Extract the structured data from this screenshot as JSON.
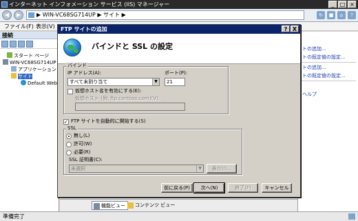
{
  "window": {
    "title": "インターネット インフォメーション サービス (IIS) マネージャー",
    "controls": {
      "minimize": "_",
      "maximize": "□",
      "close": "×"
    }
  },
  "address": {
    "back": "◀",
    "forward": "▶",
    "path": "▶ WIN-VC68SG714UP ▶ サイト ▶",
    "right_icons": [
      "refresh-icon",
      "stop-icon",
      "home-icon",
      "help-icon"
    ]
  },
  "menu": {
    "file": "ファイル(F)",
    "view": "表示(V)"
  },
  "left_pane": {
    "header": "接続",
    "tree": [
      {
        "label": "スタート ページ",
        "icon": "start-page-icon"
      },
      {
        "label": "WIN-VC68SG714UP",
        "icon": "server-icon"
      },
      {
        "label": "アプリケーション",
        "icon": "app-pool-icon"
      },
      {
        "label": "サイト",
        "icon": "sites-folder-icon"
      },
      {
        "label": "Default Web",
        "icon": "globe-icon"
      }
    ]
  },
  "right_pane": {
    "links": [
      "トの追加...",
      "トの既定値の設定...",
      "トの追加...",
      "トの既定値の設定...",
      "ヘルプ"
    ]
  },
  "view_tabs": {
    "features": "機能ビュー",
    "content": "コンテンツ ビュー"
  },
  "status": {
    "text": "準備完了"
  },
  "dialog": {
    "title": "FTP サイトの追加",
    "help_btn": "?",
    "close_btn": "X",
    "heading": "バインドと SSL の設定",
    "binding": {
      "group": "バインド",
      "ip_label": "IP アドレス(A):",
      "ip_value": "すべて未割り当て",
      "port_label": "ポート(P):",
      "port_value": "21",
      "vhost_check_label": "仮想ホスト名を有効にする(E):",
      "vhost_checked": false,
      "vhost_label": "仮想ホスト (例: ftp.contoso.com)(V):",
      "vhost_value": ""
    },
    "autostart": {
      "label": "FTP サイトを自動的に開始する(S)",
      "checked": true
    },
    "ssl": {
      "group": "SSL",
      "options": [
        "無し(L)",
        "許可(W)",
        "必要(R)"
      ],
      "selected": "無し(L)",
      "cert_label": "SSL 証明書(C):",
      "cert_value": "未選択",
      "view_btn": "表示(I)..."
    },
    "buttons": {
      "prev": "前に戻る(P)",
      "next": "次へ(N)",
      "finish": "終了(F)",
      "cancel": "キャンセル"
    }
  }
}
